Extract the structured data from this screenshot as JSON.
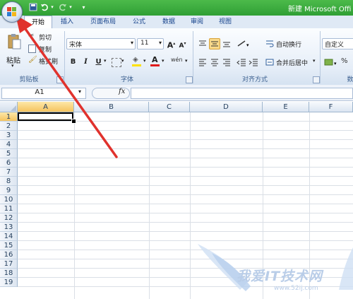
{
  "window": {
    "title": "新建 Microsoft Offi"
  },
  "quick_access": [
    "save-icon",
    "undo-icon",
    "redo-icon",
    "customize-icon"
  ],
  "tabs": [
    {
      "label": "开始",
      "active": true
    },
    {
      "label": "插入"
    },
    {
      "label": "页面布局"
    },
    {
      "label": "公式"
    },
    {
      "label": "数据"
    },
    {
      "label": "审阅"
    },
    {
      "label": "视图"
    }
  ],
  "ribbon": {
    "clipboard": {
      "label": "剪贴板",
      "paste": "粘贴",
      "cut": "剪切",
      "copy": "复制",
      "format_painter": "格式刷"
    },
    "font": {
      "label": "字体",
      "font_name": "宋体",
      "font_size": "11",
      "bold": "B",
      "italic": "I",
      "underline": "U",
      "grow": "A",
      "shrink": "A",
      "phonetic": "wén"
    },
    "alignment": {
      "label": "对齐方式",
      "wrap_text": "自动换行",
      "merge_center": "合并后居中"
    },
    "number": {
      "label": "数",
      "format": "自定义"
    }
  },
  "formula_bar": {
    "name_box": "A1",
    "fx": "fx",
    "formula": ""
  },
  "grid": {
    "columns": [
      "A",
      "B",
      "C",
      "D",
      "E",
      "F"
    ],
    "rows": [
      "1",
      "2",
      "3",
      "4",
      "5",
      "6",
      "7",
      "8",
      "9",
      "10",
      "11",
      "12",
      "13",
      "14",
      "15",
      "16",
      "17",
      "18",
      "19"
    ],
    "active_cell": "A1"
  },
  "watermark": {
    "text": "我爱IT技术网",
    "url": "www.52ij.com"
  },
  "colors": {
    "title_bar": "#2f9f35",
    "arrow": "#e0322d",
    "ribbon": "#e6eef8"
  }
}
